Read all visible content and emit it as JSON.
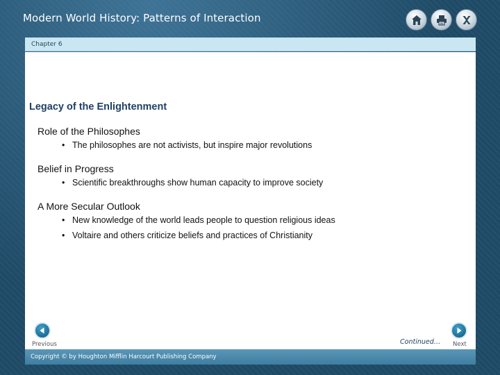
{
  "header": {
    "title": "Modern World History: Patterns of Interaction",
    "icons": [
      "home-icon",
      "print-icon",
      "close-icon"
    ]
  },
  "chapter": {
    "label": "Chapter 6"
  },
  "slide": {
    "heading": "Legacy of the Enlightenment",
    "sections": [
      {
        "title": "Role of the Philosophes",
        "bullets": [
          "The philosophes are not activists, but inspire major revolutions"
        ]
      },
      {
        "title": "Belief in Progress",
        "bullets": [
          "Scientific breakthroughs show human capacity to improve society"
        ]
      },
      {
        "title": "A More Secular Outlook",
        "bullets": [
          "New knowledge of the world leads people to question religious ideas",
          "Voltaire and others criticize beliefs and practices of Christianity"
        ]
      }
    ]
  },
  "nav": {
    "previous_label": "Previous",
    "next_label": "Next",
    "continued": "Continued…"
  },
  "footer": {
    "copyright": "Copyright © by Houghton Mifflin Harcourt Publishing Company"
  },
  "colors": {
    "background": "#1e4a66",
    "chapter_bar": "#c9e6f2",
    "heading": "#1f3f66",
    "nav_button": "#1e6f99",
    "footer": "#4a88ab"
  }
}
